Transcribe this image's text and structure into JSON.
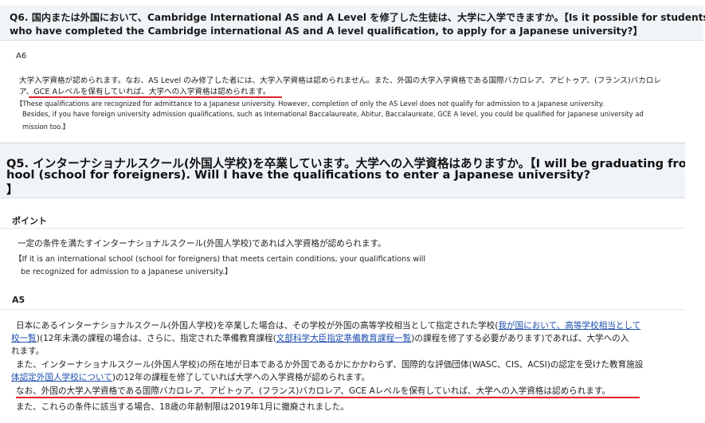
{
  "q6": {
    "title_line1": "Q6. 国内または外国において、Cambridge International AS and A Level を修了した生徒は、大学に入学できますか。【Is it possible for students",
    "title_line2": "who have completed the Cambridge international AS and A level qualification, to apply for a Japanese university?】",
    "answer_label": "A6",
    "jp_line1": "大学入学資格が認められます。なお、AS Level のみ修了した者には、大学入学資格は認められません。また、外国の大学入学資格である国際バカロレア、アビトゥア、(フランス)バカロレ",
    "jp_line2": "ア、GCE Aレベルを保有していれば、大学への入学資格は認められます。",
    "en_line1": "【These qualifications are recognized for admittance to a Japanese university. However, completion of only the AS Level does not qualify for admission to a Japanese university.",
    "en_line2": "Besides, if you have foreign university admission qualifications, such as International Baccalaureate, Abitur, Baccalaureate, GCE A level, you could be qualified for Japanese university ad",
    "en_line3": "mission too.】"
  },
  "q5": {
    "title_line1": "Q5. インターナショナルスクール(外国人学校)を卒業しています。大学への入学資格はありますか。【I will be graduating from an in",
    "title_line2": "hool (school for foreigners). Will I have the qualifications to enter a Japanese university?",
    "title_line3": "】",
    "point_label": "ポイント",
    "point_jp": "一定の条件を満たすインターナショナルスクール(外国人学校)であれば入学資格が認められます。",
    "point_en1": "【If it is an international school (school for foreigners) that meets certain conditions, your qualifications will",
    "point_en2": "be recognized for admission to a Japanese university.】",
    "answer_label": "A5",
    "a5_l1_a": "日本にあるインターナショナルスクール(外国人学校)を卒業した場合は、その学校が外国の高等学校相当として指定された学校(",
    "a5_l1_link": "我が国において、高等学校相当として",
    "a5_l2_link": "校一覧",
    "a5_l2_a": ")(12年未満の課程の場合は、さらに、指定された準備教育課程(",
    "a5_l2_link2": "文部科学大臣指定準備教育課程一覧",
    "a5_l2_b": ")の課程を修了する必要があります)であれば、大学への入",
    "a5_l3": "れます。",
    "a5_l4": "また、インターナショナルスクール(外国人学校)の所在地が日本であるか外国であるかにかかわらず、国際的な評価団体(WASC、CIS、ACSI)の認定を受けた教育施設",
    "a5_l5_link": "体認定外国人学校について",
    "a5_l5_a": ")の12年の課程を修了していれば大学への入学資格が認められます。",
    "a5_l6": "なお、外国の大学入学資格である国際バカロレア、アビトゥア、(フランス)バカロレア、GCE Aレベルを保有していれば、大学への入学資格は認められます。",
    "a5_l7": "また、これらの条件に該当する場合、18歳の年齢制限は2019年1月に撤廃されました。"
  },
  "colors": {
    "underline": "#e0232a",
    "link": "#1f4fb0",
    "title_bg": "#f0f4f8"
  }
}
